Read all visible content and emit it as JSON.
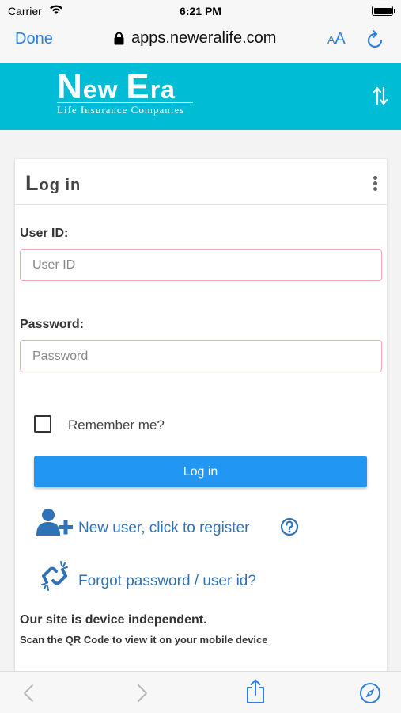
{
  "status": {
    "carrier": "Carrier",
    "time": "6:21 PM"
  },
  "browser": {
    "done_label": "Done",
    "url": "apps.neweralife.com",
    "text_size_small": "A",
    "text_size_large": "A"
  },
  "brand": {
    "name_first_letter": "N",
    "name_rest": "ew ",
    "name_second_letter": "E",
    "name_second_rest": "ra",
    "subtitle": "Life Insurance Companies"
  },
  "card": {
    "title_first_letter": "L",
    "title_rest": "og in",
    "userid_label": "User ID:",
    "userid_placeholder": "User ID",
    "password_label": "Password:",
    "password_placeholder": "Password",
    "remember_label": "Remember me?",
    "login_button": "Log in",
    "register_link": "New user, click to register",
    "forgot_link": "Forgot password / user id?",
    "device_heading": "Our site is device independent.",
    "device_sub": "Scan the QR Code to view it on your mobile device"
  },
  "colors": {
    "header_bg": "#00bcd4",
    "button_bg": "#2196f3",
    "link": "#2f72b8",
    "ios_blue": "#2f7fe0"
  },
  "icons": [
    "wifi-icon",
    "battery-icon",
    "lock-icon",
    "reload-icon",
    "sort-icon",
    "kebab-icon",
    "add-user-icon",
    "help-icon",
    "broken-link-icon",
    "back-icon",
    "forward-icon",
    "share-icon",
    "compass-icon"
  ]
}
